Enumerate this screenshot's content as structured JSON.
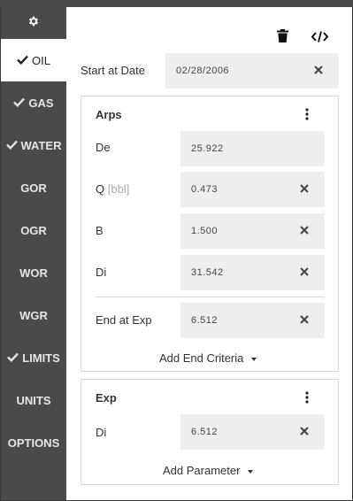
{
  "sidebar": {
    "settings_icon": "gear-icon",
    "items": [
      {
        "label": "OIL",
        "checked": true,
        "active": true
      },
      {
        "label": "GAS",
        "checked": true,
        "active": false
      },
      {
        "label": "WATER",
        "checked": true,
        "active": false
      },
      {
        "label": "GOR",
        "checked": false,
        "active": false
      },
      {
        "label": "OGR",
        "checked": false,
        "active": false
      },
      {
        "label": "WOR",
        "checked": false,
        "active": false
      },
      {
        "label": "WGR",
        "checked": false,
        "active": false
      },
      {
        "label": "LIMITS",
        "checked": true,
        "active": false
      },
      {
        "label": "UNITS",
        "checked": false,
        "active": false
      },
      {
        "label": "OPTIONS",
        "checked": false,
        "active": false
      }
    ]
  },
  "toolbar": {
    "delete_icon": "trash-icon",
    "code_icon": "code-icon"
  },
  "start": {
    "label": "Start at Date",
    "value": "02/28/2006"
  },
  "arps": {
    "title": "Arps",
    "params": [
      {
        "label": "De",
        "value": "25.922",
        "clearable": false
      },
      {
        "label": "Q",
        "unit": "[bbl]",
        "value": "0.473",
        "clearable": true
      },
      {
        "label": "B",
        "value": "1.500",
        "clearable": true
      },
      {
        "label": "Di",
        "value": "31.542",
        "clearable": true
      }
    ],
    "end": {
      "label": "End at Exp",
      "value": "6.512"
    },
    "add_label": "Add End Criteria"
  },
  "exp": {
    "title": "Exp",
    "params": [
      {
        "label": "Di",
        "value": "6.512"
      }
    ],
    "add_label": "Add Parameter"
  },
  "colors": {
    "sidebar_bg": "#4a4a4a",
    "field_bg": "#eeeeee",
    "border": "#d8d8d8"
  }
}
